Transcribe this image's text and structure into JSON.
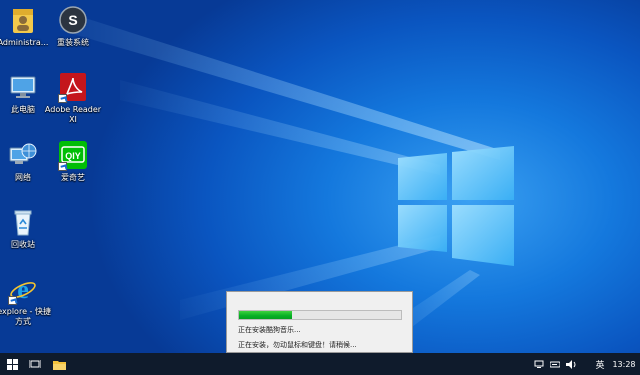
{
  "desktop": {
    "icons": [
      {
        "label": "Administra...",
        "icon": "user-folder-icon"
      },
      {
        "label": "重装系统",
        "icon": "reinstall-system-icon"
      },
      {
        "label": "此电脑",
        "icon": "this-pc-icon"
      },
      {
        "label": "Adobe Reader XI",
        "icon": "adobe-reader-icon"
      },
      {
        "label": "网络",
        "icon": "network-icon"
      },
      {
        "label": "爱奇艺",
        "icon": "iqiyi-icon"
      },
      {
        "label": "回收站",
        "icon": "recycle-bin-icon"
      },
      {
        "label": "iexplore - 快捷方式",
        "icon": "internet-explorer-icon"
      }
    ]
  },
  "install_dialog": {
    "progress": 0.33,
    "status_line1": "正在安装酷狗音乐...",
    "status_line2": "正在安装，勿动鼠标和键盘！请稍候..."
  },
  "taskbar": {
    "start_icon": "windows-start-icon",
    "taskview_icon": "task-view-icon",
    "explorer_icon": "file-explorer-icon",
    "tray": {
      "ime_label": "英",
      "time": "13:28"
    }
  },
  "colors": {
    "wallpaper_blue": "#0a55c0",
    "progress_green": "#06b025",
    "taskbar": "#0f1b2c"
  }
}
